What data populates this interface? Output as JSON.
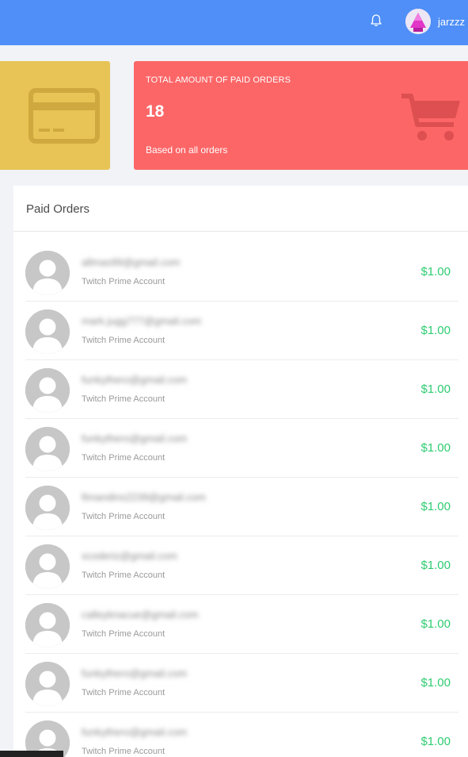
{
  "header": {
    "username": "jarzzz",
    "icons": {
      "notifications": "bell-icon",
      "avatar": "user-avatar"
    }
  },
  "stats": {
    "card_yellow": {
      "icon": "credit-card-icon",
      "color": "#e7c455"
    },
    "card_red": {
      "label": "TOTAL AMOUNT OF PAID ORDERS",
      "value": "18",
      "sub": "Based on all orders",
      "icon": "shopping-cart-icon",
      "color": "#fc6667"
    }
  },
  "orders": {
    "title": "Paid Orders",
    "price_color": "#2ecc71",
    "items": [
      {
        "email": "allmas99@gmail.com",
        "product": "Twitch Prime Account",
        "price": "$1.00"
      },
      {
        "email": "mark.jugg777@gmail.com",
        "product": "Twitch Prime Account",
        "price": "$1.00"
      },
      {
        "email": "funkythero@gmail.com",
        "product": "Twitch Prime Account",
        "price": "$1.00"
      },
      {
        "email": "funkythero@gmail.com",
        "product": "Twitch Prime Account",
        "price": "$1.00"
      },
      {
        "email": "fimandins2239@gmail.com",
        "product": "Twitch Prime Account",
        "price": "$1.00"
      },
      {
        "email": "scoderiz@gmail.com",
        "product": "Twitch Prime Account",
        "price": "$1.00"
      },
      {
        "email": "calleyknacue@gmail.com",
        "product": "Twitch Prime Account",
        "price": "$1.00"
      },
      {
        "email": "funkythero@gmail.com",
        "product": "Twitch Prime Account",
        "price": "$1.00"
      },
      {
        "email": "funkythero@gmail.com",
        "product": "Twitch Prime Account",
        "price": "$1.00"
      }
    ]
  }
}
